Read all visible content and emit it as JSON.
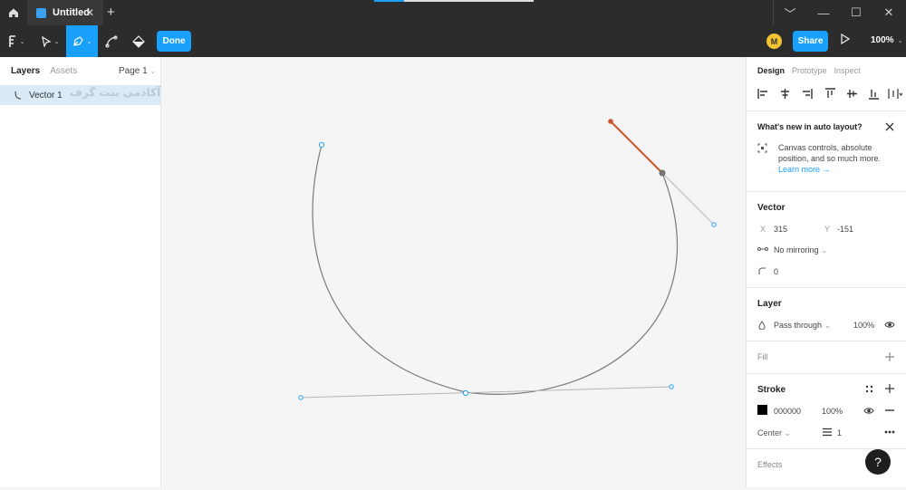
{
  "titlebar": {
    "tab_title": "Untitled",
    "close_glyph": "✕",
    "new_tab_glyph": "+",
    "upload_progress": 0.19,
    "window_controls": [
      "﹀",
      "—",
      "☐",
      "✕"
    ]
  },
  "toolbar": {
    "done_label": "Done",
    "avatar_initial": "M",
    "share_label": "Share",
    "zoom_label": "100%",
    "caret": "⌄"
  },
  "layers_panel": {
    "tab_layers": "Layers",
    "tab_assets": "Assets",
    "page_label": "Page 1",
    "layer_name": "Vector 1",
    "watermark": "آکادمی بیت گرف"
  },
  "design_panel": {
    "tab_design": "Design",
    "tab_prototype": "Prototype",
    "tab_inspect": "Inspect",
    "notice": {
      "title": "What's new in auto layout?",
      "body": "Canvas controls, absolute position, and so much more.",
      "link": "Learn more →"
    },
    "vector": {
      "title": "Vector",
      "x_label": "X",
      "x_value": "315",
      "y_label": "Y",
      "y_value": "-151",
      "mirroring": "No mirroring",
      "corner_radius": "0"
    },
    "layer": {
      "title": "Layer",
      "blend_mode": "Pass through",
      "opacity": "100%"
    },
    "fill": {
      "title": "Fill"
    },
    "stroke": {
      "title": "Stroke",
      "color_hex": "000000",
      "opacity": "100%",
      "position": "Center",
      "weight": "1"
    },
    "effects": {
      "title": "Effects"
    }
  },
  "help_label": "?",
  "colors": {
    "accent": "#18a0fb",
    "selected_handle": "#c8552b",
    "path": "#7a7a7a",
    "dark_chrome": "#2c2c2c"
  },
  "icons": [
    "home-icon",
    "figma-menu-icon",
    "move-tool-icon",
    "pen-tool-icon",
    "pencil-tool-icon",
    "paint-bucket-icon",
    "play-icon",
    "close-icon",
    "eye-icon",
    "plus-icon",
    "minus-icon",
    "more-icon",
    "style-grid-icon",
    "help-icon"
  ]
}
